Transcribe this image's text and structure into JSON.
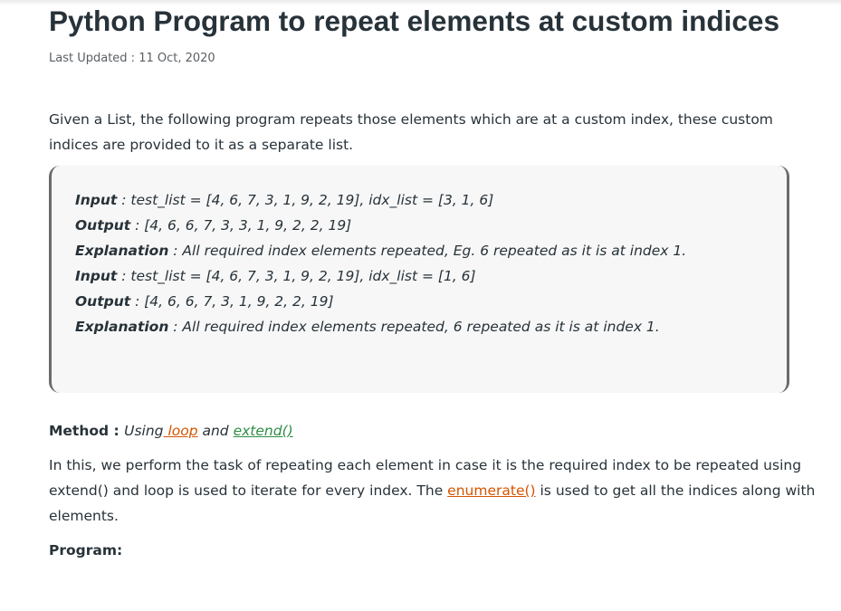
{
  "article": {
    "title": "Python Program to repeat elements at custom indices",
    "last_updated_label": "Last Updated : ",
    "last_updated_date": "11 Oct, 2020",
    "intro_line1": "Given a List, the following program repeats those elements which are at a custom index, these custom",
    "intro_line2": "indices are provided to it as a separate list."
  },
  "example": [
    {
      "label": "Input",
      "text": " : test_list = [4, 6, 7, 3, 1, 9, 2, 19], idx_list = [3, 1, 6]"
    },
    {
      "label": "Output",
      "text": " : [4, 6, 6, 7, 3, 3, 1, 9, 2, 2, 19]"
    },
    {
      "label": "Explanation",
      "text": " : All required index elements repeated, Eg. 6 repeated as it is at index 1."
    },
    {
      "label": "Input",
      "text": " : test_list = [4, 6, 7, 3, 1, 9, 2, 19], idx_list = [1, 6]"
    },
    {
      "label": "Output",
      "text": " : [4, 6, 6, 7, 3, 1, 9, 2, 2, 19]"
    },
    {
      "label": "Explanation",
      "text": " : All required index elements repeated, 6 repeated as it is at index 1."
    }
  ],
  "method": {
    "label": "Method : ",
    "using": "Using",
    "loop_link": " loop",
    "and": " and ",
    "extend_link": "extend()"
  },
  "description": {
    "line1": "In this, we perform the task of repeating each element in case it is the required index to be repeated using",
    "line2_before": "extend() and loop is used to iterate for every index. The ",
    "enumerate_link": "enumerate()",
    "line2_after": " is used to get all the indices along with",
    "line3": "elements."
  },
  "program_label": "Program:",
  "colors": {
    "text": "#273239",
    "link_orange": "#d35400",
    "link_green": "#2f8d46",
    "example_bg": "#f7f7f7",
    "example_border": "#6b6b6b"
  }
}
